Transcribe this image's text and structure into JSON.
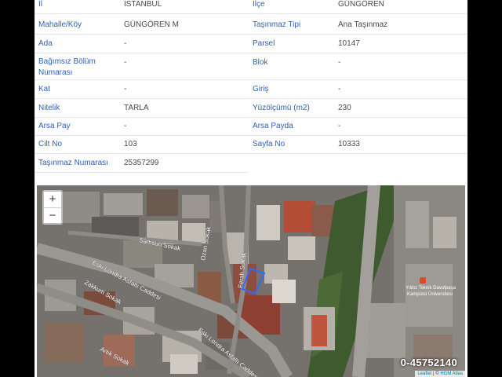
{
  "rows": [
    {
      "l1": "İl",
      "v1": "İSTANBUL",
      "l2": "İlçe",
      "v2": "GÜNGÖREN"
    },
    {
      "l1": "Mahalle/Köy",
      "v1": "GÜNGÖREN M",
      "l2": "Taşınmaz Tipi",
      "v2": "Ana Taşınmaz"
    },
    {
      "l1": "Ada",
      "v1": "-",
      "l2": "Parsel",
      "v2": "10147"
    },
    {
      "l1": "Bağımsız Bölüm Numarası",
      "v1": "-",
      "l2": "Blok",
      "v2": "-"
    },
    {
      "l1": "Kat",
      "v1": "-",
      "l2": "Giriş",
      "v2": "-"
    },
    {
      "l1": "Nitelik",
      "v1": "TARLA",
      "l2": "Yüzölçümü (m2)",
      "v2": "230"
    },
    {
      "l1": "Arsa Pay",
      "v1": "-",
      "l2": "Arsa Payda",
      "v2": "-"
    },
    {
      "l1": "Cilt No",
      "v1": "103",
      "l2": "Sayfa No",
      "v2": "10333"
    },
    {
      "l1": "Taşınmaz Numarası",
      "v1": "25357299",
      "l2": "",
      "v2": ""
    }
  ],
  "map": {
    "zoom_in": "+",
    "zoom_out": "−",
    "phone": "0-45752140",
    "attribution_leaflet": "Leaflet",
    "attribution_sep": " | © ",
    "attribution_source": "HGM Atlas",
    "streets": {
      "samsun": "Samsun Sokak",
      "ozan": "Ozan Sokak",
      "ferah": "Ferah Sokak",
      "eski_londra_1": "Eski Londra Asfaltı Caddesi",
      "zakkum": "Zakkum Sokak",
      "eski_londra_2": "Eski Londra Asfaltı Caddesi",
      "artik": "Artık Sokak"
    },
    "poi": {
      "line1": "Yıldız Teknik Davutpaşa",
      "line2": "Kampüsü Üniversitesi"
    },
    "colors": {
      "parcel": "#2f6bff",
      "label": "#2f5fb3"
    }
  }
}
